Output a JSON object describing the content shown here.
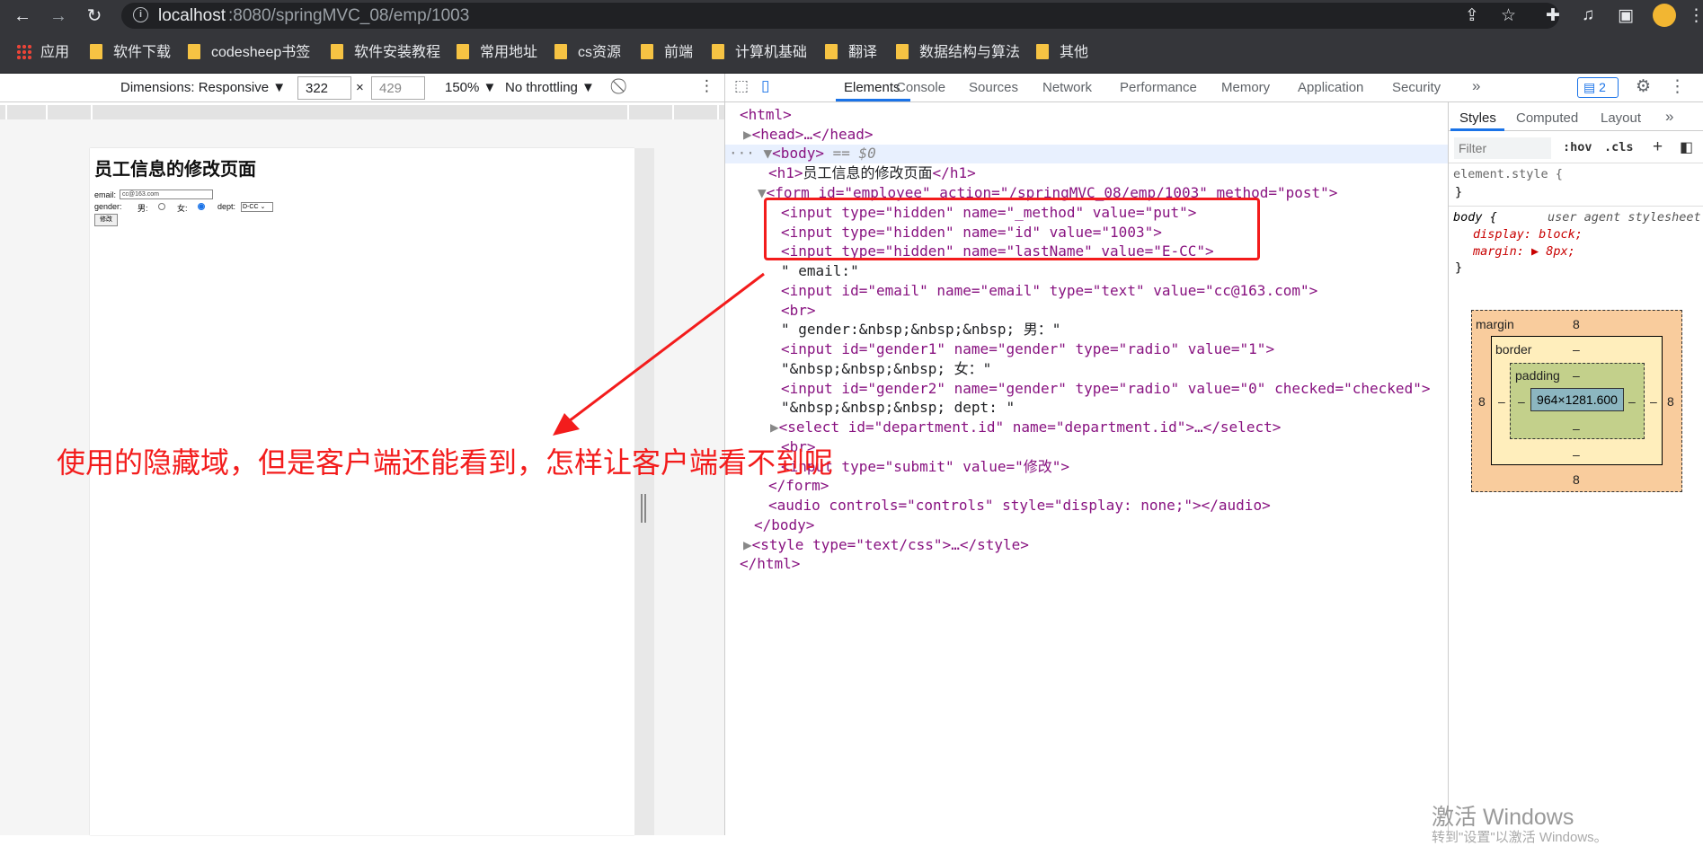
{
  "browser": {
    "url_host": "localhost",
    "url_path": ":8080/springMVC_08/emp/1003",
    "bookmarks": [
      "应用",
      "软件下载",
      "codesheep书签",
      "软件安装教程",
      "常用地址",
      "cs资源",
      "前端",
      "计算机基础",
      "翻译",
      "数据结构与算法",
      "其他"
    ]
  },
  "device_toolbar": {
    "dimensions_label": "Dimensions: Responsive ▼",
    "width": "322",
    "times": "×",
    "height": "429",
    "zoom": "150% ▼",
    "throttle": "No throttling ▼"
  },
  "page": {
    "h1": "员工信息的修改页面",
    "email_label": "email:",
    "email_value": "cc@163.com",
    "gender_label": "gender:",
    "male": "男:",
    "female": "女:",
    "dept_label": "dept:",
    "dept_value": "D-CC",
    "submit": "修改"
  },
  "devtools": {
    "tabs": [
      "Elements",
      "Console",
      "Sources",
      "Network",
      "Performance",
      "Memory",
      "Application",
      "Security"
    ],
    "more": "»",
    "badge": "2",
    "tree": {
      "l1": "<html>",
      "l2": "<head>…</head>",
      "l3a": "<body>",
      "l3b": "== $0",
      "l4a": "<h1>",
      "l4b": "员工信息的修改页面",
      "l4c": "</h1>",
      "l5": "<form id=\"employee\" action=\"/springMVC_08/emp/1003\" method=\"post\">",
      "l6": "<input type=\"hidden\" name=\"_method\" value=\"put\">",
      "l7": "<input type=\"hidden\" name=\"id\" value=\"1003\">",
      "l8": "<input type=\"hidden\" name=\"lastName\" value=\"E-CC\">",
      "l9": "\" email:\"",
      "l10": "<input id=\"email\" name=\"email\" type=\"text\" value=\"cc@163.com\">",
      "l11": "<br>",
      "l12": "\" gender:&nbsp;&nbsp;&nbsp; 男：\"",
      "l13": "<input id=\"gender1\" name=\"gender\" type=\"radio\" value=\"1\">",
      "l14": "\"&nbsp;&nbsp;&nbsp; 女：\"",
      "l15": "<input id=\"gender2\" name=\"gender\" type=\"radio\" value=\"0\" checked=\"checked\">",
      "l16": "\"&nbsp;&nbsp;&nbsp; dept: \"",
      "l17": "<select id=\"department.id\" name=\"department.id\">…</select>",
      "l18": "<br>",
      "l19": "<input type=\"submit\" value=\"修改\">",
      "l20": "</form>",
      "l21": "<audio controls=\"controls\" style=\"display: none;\"></audio>",
      "l22": "</body>",
      "l23": "<style type=\"text/css\">…</style>",
      "l24": "</html>"
    }
  },
  "styles": {
    "tabs": [
      "Styles",
      "Computed",
      "Layout"
    ],
    "filter_placeholder": "Filter",
    "hov": ":hov",
    "cls": ".cls",
    "element_style": "element.style {",
    "close": "}",
    "body_sel": "body {",
    "ua": "user agent stylesheet",
    "display": "display: block;",
    "margin": "margin: ▶ 8px;",
    "bm": {
      "margin": "margin",
      "border": "border",
      "padding": "padding",
      "content": "964×1281.600",
      "m": "8",
      "dash": "–"
    }
  },
  "annotation": "使用的隐藏域，但是客户端还能看到，怎样让客户端看不到呢",
  "watermark": "激活 Windows",
  "watermark2": "转到\"设置\"以激活 Windows。"
}
